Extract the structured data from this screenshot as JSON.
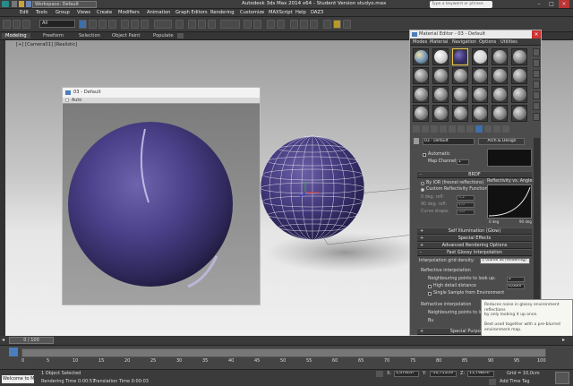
{
  "titlebar": {
    "workspace": "Workspace: Default",
    "title": "Autodesk 3ds Max  2014 x64   -  Student Version   studyo.max",
    "search_placeholder": "Type a keyword or phrase",
    "min": "–",
    "max": "□",
    "close": "×"
  },
  "menu": [
    "Edit",
    "Tools",
    "Group",
    "Views",
    "Create",
    "Modifiers",
    "Animation",
    "Graph Editors",
    "Rendering",
    "Customize",
    "MAXScript",
    "Help",
    "DAZ3"
  ],
  "toolbar": {
    "selection_set": "All"
  },
  "ribbon": {
    "tabs": [
      "Modeling",
      "Freeform",
      "Selection",
      "Object Paint",
      "Populate"
    ]
  },
  "viewport": {
    "label": "[+] [Camera01] [Realistic]"
  },
  "preview": {
    "title": "03 - Default",
    "auto_label": "Auto"
  },
  "material_editor": {
    "title": "Material Editor - 03 - Default",
    "menu": [
      "Modes",
      "Material",
      "Navigation",
      "Options",
      "Utilities"
    ],
    "material_name": "03 - Default",
    "material_type": "Arch & Design",
    "automatic_label": "Automatic",
    "map_channel_label": "Map Channel:",
    "map_channel_value": "1",
    "brdf": {
      "title": "BRDF",
      "by_ior": "By IOR (fresnel reflections)",
      "custom": "Custom Reflectivity Function",
      "zero_deg": "0 deg. refl:",
      "zero_deg_value": "0,2",
      "ninety_deg": "90 deg. refl:",
      "ninety_deg_value": "1,0",
      "curve_shape": "Curve shape:",
      "curve_shape_value": "5,0",
      "graph_title": "Reflectivity vs. Angle:",
      "graph_left": "0 deg",
      "graph_right": "90 deg"
    },
    "rollouts": {
      "self_illum": "Self Illumination (Glow)",
      "special": "Special Effects",
      "adv_rendering": "Advanced Rendering Options",
      "fast_glossy": "Fast Glossy Interpolation",
      "special_purpose": "Special Purpose Maps"
    },
    "fast_glossy": {
      "grid_density_label": "Interpolation grid density:",
      "grid_density_value": "1 (same as rendering)",
      "reflective": "Reflective interpolation",
      "neighbouring": "Neighbouring points to look up:",
      "neighbouring_value": "2",
      "high_detail": "High detail distance",
      "high_detail_value": "0,00m",
      "single_sample": "Single Sample from Environment",
      "refractive": "Refractive interpolation",
      "neighbouring_refr": "Neighbouring points to look up:",
      "refr_prefix": "Bu"
    }
  },
  "tooltip": {
    "lines": [
      "Reduces noise in glossy environment reflections",
      "by only looking it up once.",
      "",
      "Best used together with a pre-blurred",
      "environment map."
    ]
  },
  "timeline": {
    "frame_label": "0 / 100",
    "ticks": [
      "0",
      "5",
      "10",
      "15",
      "20",
      "25",
      "30",
      "35",
      "40",
      "45",
      "50",
      "55",
      "60",
      "65",
      "70",
      "75",
      "80",
      "85",
      "90",
      "95",
      "100"
    ]
  },
  "status": {
    "welcome": "Welcome to M",
    "selected": "1 Object Selected",
    "render_time": "Rendering Time  0:00:57",
    "translation_time": "Translation Time  0:00:03",
    "x_value": "1,474cm",
    "y_value": "-10,711cm",
    "z_value": "11,798cm",
    "grid": "Grid = 10,0cm",
    "autokey": "Auto Key",
    "selected_dropdown": "Selected",
    "setkey": "Set Key",
    "keyfilters": "Key Filters...",
    "add_time_tag": "Add Time Tag"
  },
  "colors": {
    "material": "#3e3576",
    "accent": "#3f6fa8",
    "slot_selected": "#e8c64a"
  }
}
